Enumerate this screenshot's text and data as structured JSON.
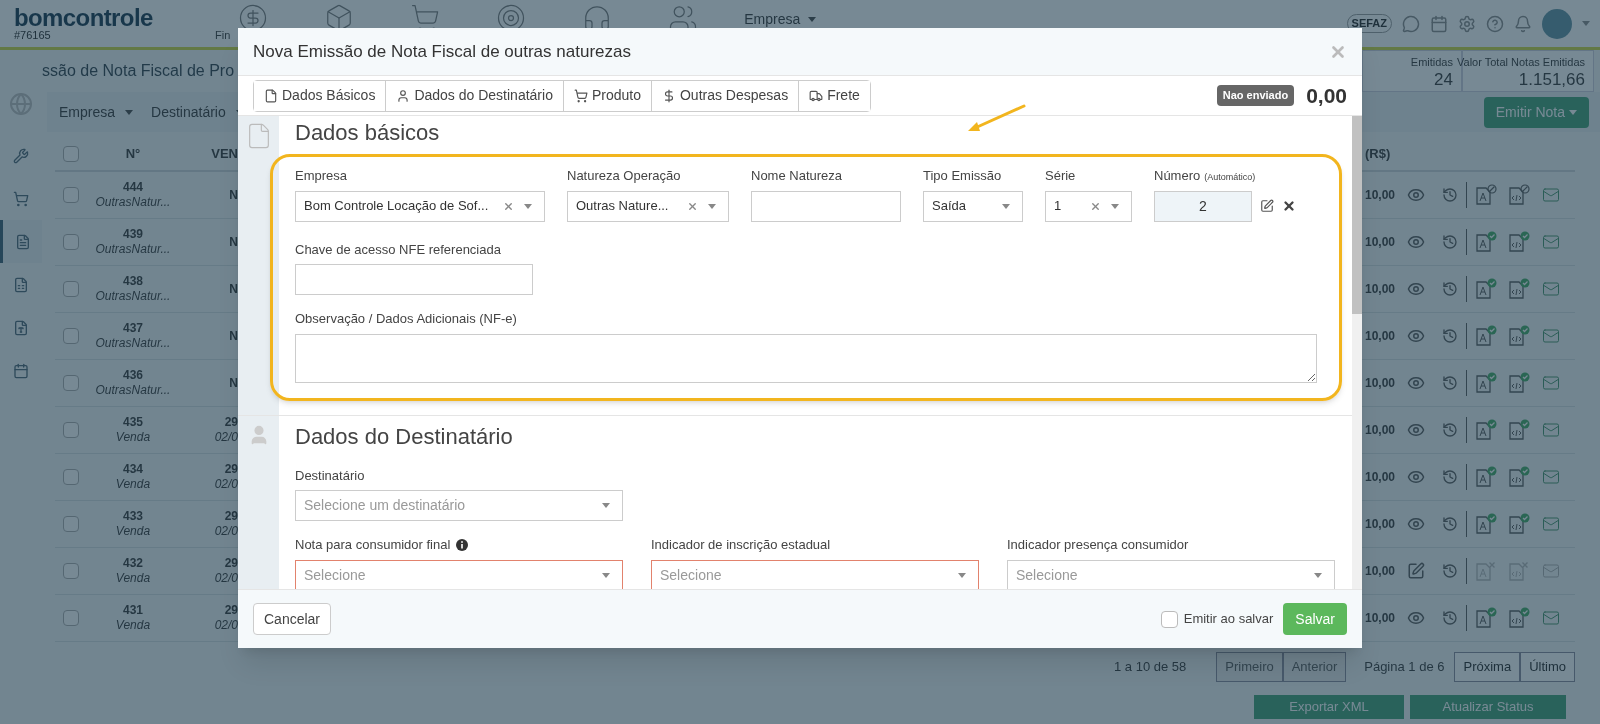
{
  "app": {
    "logo": "bomcontrole",
    "account": "#76165",
    "nav_partial": "Fin",
    "company_menu": "Empresa",
    "sefaz": "SEFAZ"
  },
  "sidebar": {
    "items": [
      {
        "selected": false
      },
      {
        "selected": false
      },
      {
        "selected": true
      },
      {
        "selected": false
      },
      {
        "selected": false
      },
      {
        "selected": false
      }
    ]
  },
  "page": {
    "title": "ssão de Nota Fiscal de Pro",
    "stats": [
      {
        "label": "Emitidas",
        "value": "24"
      },
      {
        "label": "Valor Total Notas Emitidas",
        "value": "1.151,66"
      }
    ],
    "filters": [
      "Empresa",
      "Destinatário"
    ],
    "emit_button": "Emitir Nota"
  },
  "table": {
    "all_checked": false,
    "columns": [
      "N°",
      "VEN",
      "(R$)"
    ],
    "rows": [
      {
        "checked": false,
        "number": "444",
        "type": "OutrasNatur...",
        "column_3": "N",
        "value": "10,00",
        "kind": "blocked"
      },
      {
        "checked": false,
        "number": "439",
        "type": "OutrasNatur...",
        "column_3": "N",
        "value": "10,00",
        "kind": "issued"
      },
      {
        "checked": false,
        "number": "438",
        "type": "OutrasNatur...",
        "column_3": "N",
        "value": "10,00",
        "kind": "issued"
      },
      {
        "checked": false,
        "number": "437",
        "type": "OutrasNatur...",
        "column_3": "N",
        "value": "10,00",
        "kind": "issued"
      },
      {
        "checked": false,
        "number": "436",
        "type": "OutrasNatur...",
        "column_3": "N",
        "value": "10,00",
        "kind": "issued"
      },
      {
        "checked": false,
        "number": "435",
        "type": "Venda",
        "column_3": "29",
        "column_3_sub": "02/0",
        "value": "10,00",
        "kind": "issued"
      },
      {
        "checked": false,
        "number": "434",
        "type": "Venda",
        "column_3": "29",
        "column_3_sub": "02/0",
        "value": "10,00",
        "kind": "issued"
      },
      {
        "checked": false,
        "number": "433",
        "type": "Venda",
        "column_3": "29",
        "column_3_sub": "02/0",
        "value": "10,00",
        "kind": "issued"
      },
      {
        "checked": false,
        "number": "432",
        "type": "Venda",
        "column_3": "29",
        "column_3_sub": "02/0",
        "value": "10,00",
        "kind": "draft"
      },
      {
        "checked": false,
        "number": "431",
        "type": "Venda",
        "column_3": "29",
        "column_3_sub": "02/0",
        "value": "10,00",
        "kind": "issued"
      }
    ]
  },
  "pagination": {
    "summary": "1 a 10 de 58",
    "items": [
      {
        "kind": "button",
        "label": "Primeiro",
        "disabled": true
      },
      {
        "kind": "button",
        "label": "Anterior",
        "disabled": true
      },
      {
        "kind": "text",
        "label": "Página 1 de 6"
      },
      {
        "kind": "button",
        "label": "Próxima",
        "disabled": false
      },
      {
        "kind": "button",
        "label": "Último",
        "disabled": false
      }
    ]
  },
  "page_actions": [
    "Exportar XML",
    "Atualizar Status"
  ],
  "modal": {
    "title": "Nova Emissão de Nota Fiscal de outras naturezas",
    "tabs": [
      {
        "label": "Dados Básicos"
      },
      {
        "label": "Dados do Destinatário"
      },
      {
        "label": "Produto"
      },
      {
        "label": "Outras Despesas"
      },
      {
        "label": "Frete"
      }
    ],
    "status_badge": "Nao enviado",
    "total": "0,00",
    "basic": {
      "title": "Dados básicos",
      "fields": [
        {
          "label": "Empresa",
          "kind": "select",
          "value": "Bom Controle Locação de Sof...",
          "clearable": true
        },
        {
          "label": "Natureza Operação",
          "kind": "select",
          "value": "Outras Nature...",
          "clearable": true
        },
        {
          "label": "Nome Natureza",
          "kind": "text"
        },
        {
          "label": "Tipo Emissão",
          "kind": "select",
          "value": "Saída",
          "clearable": false
        },
        {
          "label": "Série",
          "kind": "select",
          "value": "1",
          "clearable": true
        },
        {
          "label": "Número",
          "hint": "(Automático)",
          "kind": "number",
          "value": "2"
        }
      ],
      "access_key": {
        "label": "Chave de acesso NFE referenciada"
      },
      "notes": {
        "label": "Observação / Dados Adicionais (NF-e)"
      }
    },
    "recipient": {
      "title": "Dados do Destinatário",
      "recipient_field": {
        "label": "Destinatário",
        "placeholder": "Selecione um destinatário"
      },
      "fields": [
        {
          "label": "Nota para consumidor final",
          "info": true,
          "placeholder": "Selecione",
          "invalid": true
        },
        {
          "label": "Indicador de inscrição estadual",
          "info": false,
          "placeholder": "Selecione",
          "invalid": true
        },
        {
          "label": "Indicador presença consumidor",
          "info": false,
          "placeholder": "Selecione",
          "invalid": false
        }
      ]
    },
    "footer": {
      "cancel": "Cancelar",
      "emit_on_save": {
        "label": "Emitir ao salvar",
        "checked": false
      },
      "save": "Salvar"
    }
  }
}
